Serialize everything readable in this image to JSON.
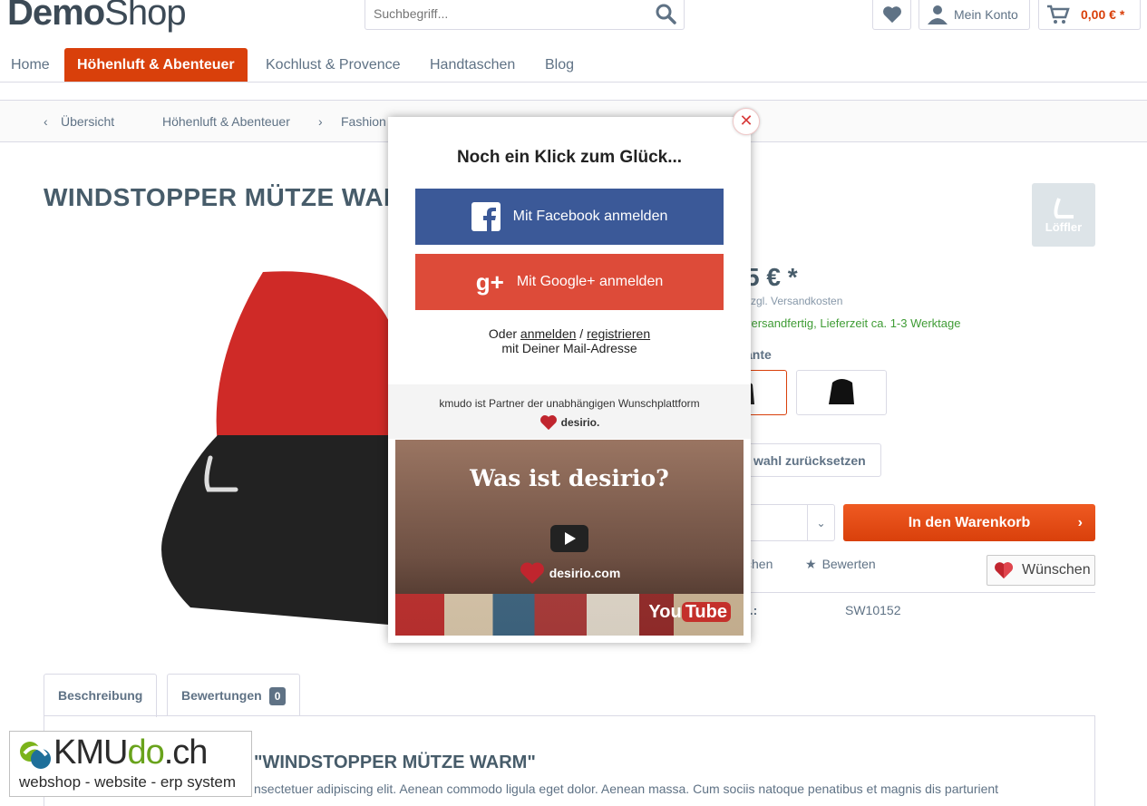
{
  "header": {
    "logo_bold": "Demo",
    "logo_light": "Shop",
    "search_placeholder": "Suchbegriff...",
    "account_label": "Mein Konto",
    "cart_amount": "0,00 € *"
  },
  "nav": {
    "items": [
      {
        "label": "Home"
      },
      {
        "label": "Höhenluft & Abenteuer"
      },
      {
        "label": "Kochlust & Provence"
      },
      {
        "label": "Handtaschen"
      },
      {
        "label": "Blog"
      }
    ]
  },
  "breadcrumb": {
    "back": "Übersicht",
    "items": [
      "Höhenluft & Abenteuer",
      "Fashion"
    ]
  },
  "product": {
    "title": "WINDSTOPPER MÜTZE WARM",
    "brand_logo": "Löffler",
    "price": "5 € *",
    "shipping": "zzgl. Versandkosten",
    "delivery": "versandfertig, Lieferzeit ca. 1-3 Werktage",
    "variant_label": "ante",
    "reset_label": "wahl zurücksetzen",
    "add_to_cart": "In den Warenkorb",
    "compare": "chen",
    "rate": "Bewerten",
    "wish": "Wünschen",
    "article_label": "r.:",
    "article_number": "SW10152"
  },
  "tabs": {
    "description": "Beschreibung",
    "reviews": "Bewertungen",
    "reviews_count": "0"
  },
  "content": {
    "heading": "\"WINDSTOPPER MÜTZE WARM\"",
    "text": "nsectetuer adipiscing elit. Aenean commodo ligula eget dolor. Aenean massa. Cum sociis natoque penatibus et magnis dis parturient"
  },
  "kmudo": {
    "brand_a": "KMU",
    "brand_b": "do",
    "brand_c": ".ch",
    "tagline": "webshop - website - erp system"
  },
  "modal": {
    "title": "Noch ein Klick zum Glück...",
    "facebook": "Mit Facebook anmelden",
    "google": "Mit Google+ anmelden",
    "oder": "Oder",
    "login": "anmelden",
    "slash": "/",
    "register": "registrieren",
    "mail": "mit Deiner Mail-Adresse",
    "partner": "kmudo ist Partner der unabhängigen Wunschplattform",
    "desirio": "desirio.",
    "video_title": "Was ist desirio?",
    "video_brand": "desirio.com",
    "youtube_a": "You",
    "youtube_b": "Tube"
  },
  "colors": {
    "accent": "#d9400b",
    "facebook": "#3b5998",
    "google": "#dd4b39"
  }
}
